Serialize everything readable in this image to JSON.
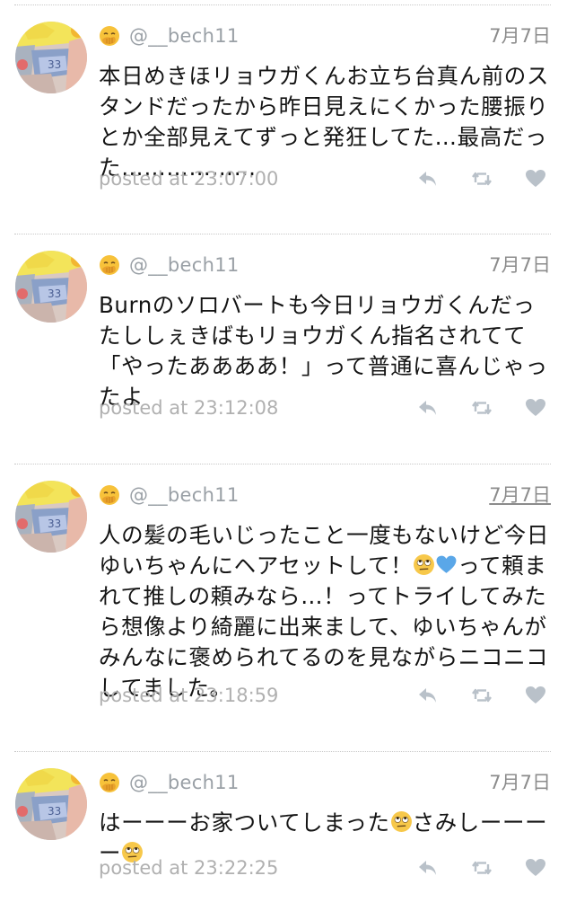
{
  "tweets": [
    {
      "username": "@__bech11",
      "date": "7月7日",
      "date_underlined": false,
      "text_parts": [
        {
          "type": "text",
          "value": "本日めきほリョウガくんお立ち台真ん前のスタンドだったから昨日見えにくかった腰振りとか全部見えてずっと発狂してた…最高だった………………"
        }
      ],
      "posted": "posted at 23:07:00"
    },
    {
      "username": "@__bech11",
      "date": "7月7日",
      "date_underlined": false,
      "text_parts": [
        {
          "type": "text",
          "value": "Burnのソロバートも今日リョウガくんだったししぇきばもリョウガくん指名されてて「やったああああ！」って普通に喜んじゃったよ"
        }
      ],
      "posted": "posted at 23:12:08"
    },
    {
      "username": "@__bech11",
      "date": "7月7日",
      "date_underlined": true,
      "text_parts": [
        {
          "type": "text",
          "value": "人の髪の毛いじったこと一度もないけど今日ゆいちゃんにヘアセットして！"
        },
        {
          "type": "emoji",
          "value": "face-with-rolling-eyes"
        },
        {
          "type": "emoji",
          "value": "blue-heart"
        },
        {
          "type": "text",
          "value": "って頼まれて推しの頼みなら…！ってトライしてみたら想像より綺麗に出来まして、ゆいちゃんがみんなに褒められてるのを見ながらニコニコしてました。"
        }
      ],
      "posted": "posted at 23:18:59"
    },
    {
      "username": "@__bech11",
      "date": "7月7日",
      "date_underlined": false,
      "text_parts": [
        {
          "type": "text",
          "value": "はーーーお家ついてしまった"
        },
        {
          "type": "emoji",
          "value": "face-with-rolling-eyes"
        },
        {
          "type": "text",
          "value": "さみしーーーー"
        },
        {
          "type": "emoji",
          "value": "face-with-rolling-eyes"
        }
      ],
      "posted": "posted at 23:22:25"
    }
  ],
  "icons": {
    "user_badge": "hand-over-mouth-emoji-icon",
    "reply": "reply-icon",
    "retweet": "retweet-icon",
    "like": "heart-icon"
  },
  "colors": {
    "icon_gray": "#b9c1c9",
    "meta_gray": "#9aa0a6",
    "posted_gray": "#b0b0b0",
    "separator": "#c8c8c8"
  }
}
